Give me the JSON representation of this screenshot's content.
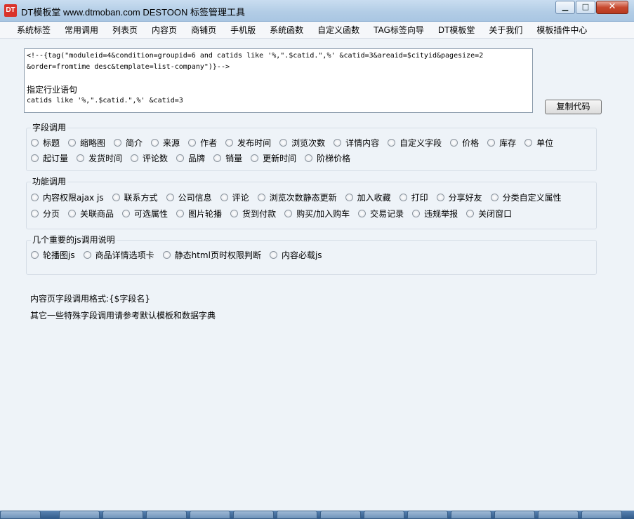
{
  "window": {
    "icon_text": "DT",
    "title": "DT模板堂 www.dtmoban.com DESTOON 标签管理工具",
    "minimize_glyph": "▁",
    "maximize_glyph": "□",
    "close_glyph": "✕"
  },
  "menu": [
    "系统标签",
    "常用调用",
    "列表页",
    "内容页",
    "商铺页",
    "手机版",
    "系统函数",
    "自定义函数",
    "TAG标签向导",
    "DT模板堂",
    "关于我们",
    "模板插件中心"
  ],
  "code": {
    "line1": "<!--{tag(\"moduleid=4&condition=groupid=6 and catids like '%,\".$catid.\",%' &catid=3&areaid=$cityid&pagesize=2",
    "line2": "&order=fromtime desc&template=list-company\")}-->",
    "label": "指定行业语句",
    "line3": "catids like '%,\".$catid.\",%' &catid=3"
  },
  "copy_button": "复制代码",
  "groups": {
    "fields": {
      "title": "字段调用",
      "row1": [
        "标题",
        "缩略图",
        "简介",
        "来源",
        "作者",
        "发布时间",
        "浏览次数",
        "详情内容",
        "自定义字段",
        "价格",
        "库存",
        "单位"
      ],
      "row2": [
        "起订量",
        "发货时间",
        "评论数",
        "品牌",
        "销量",
        "更新时间",
        "阶梯价格"
      ]
    },
    "functions": {
      "title": "功能调用",
      "row1": [
        "内容权限ajax js",
        "联系方式",
        "公司信息",
        "评论",
        "浏览次数静态更新",
        "加入收藏",
        "打印",
        "分享好友",
        "分类自定义属性"
      ],
      "row2": [
        "分页",
        "关联商品",
        "可选属性",
        "图片轮播",
        "货到付款",
        "购买/加入购车",
        "交易记录",
        "违规举报",
        "关闭窗口"
      ]
    },
    "js": {
      "title": "几个重要的js调用说明",
      "row1": [
        "轮播图js",
        "商品详情选项卡",
        "静态html页时权限判断",
        "内容必载js"
      ]
    }
  },
  "info": {
    "line1": "内容页字段调用格式:{$字段名}",
    "line2": "其它一些特殊字段调用请参考默认模板和数据字典"
  }
}
